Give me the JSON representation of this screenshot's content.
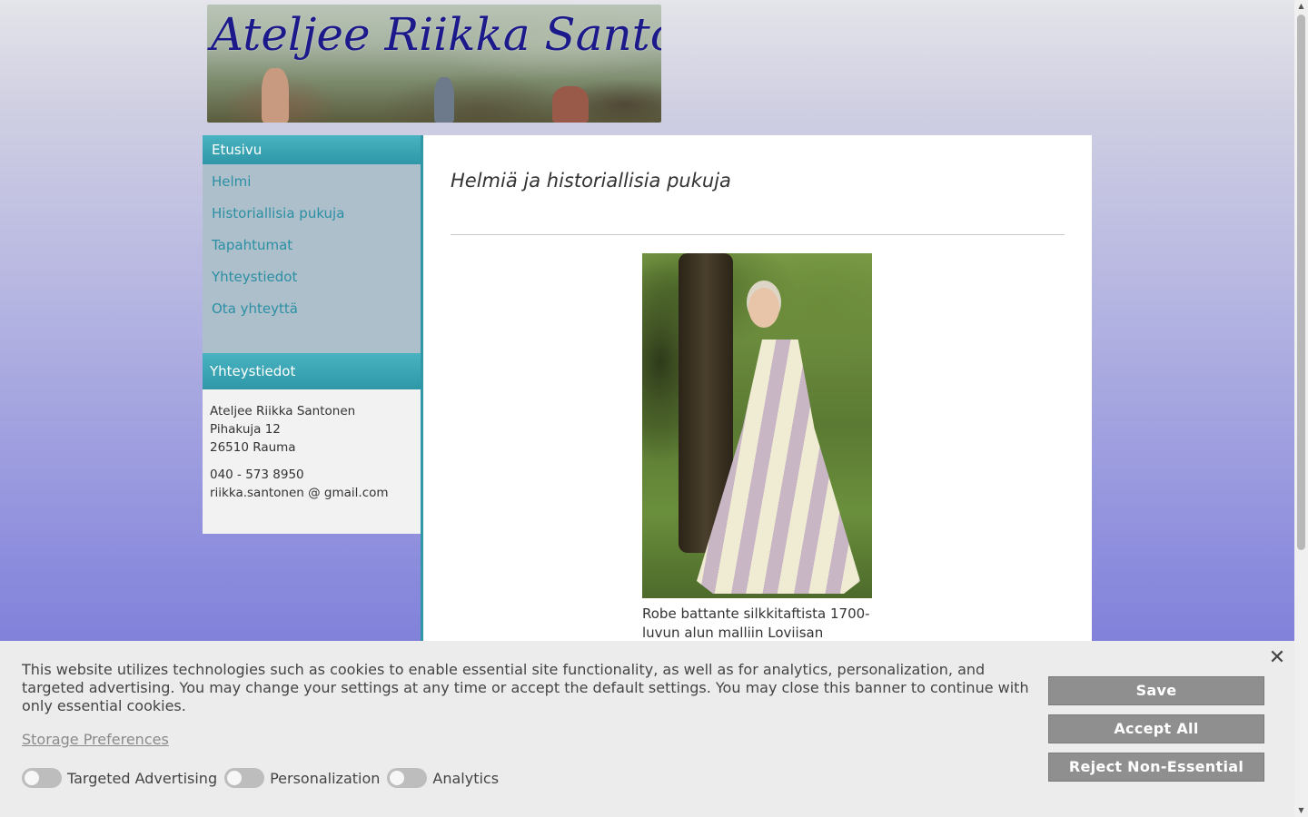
{
  "site": {
    "banner_title": "Ateljee Riikka Santonen"
  },
  "nav": {
    "items": [
      {
        "label": "Etusivu",
        "active": true
      },
      {
        "label": "Helmi"
      },
      {
        "label": "Historiallisia pukuja"
      },
      {
        "label": "Tapahtumat"
      },
      {
        "label": "Yhteystiedot"
      },
      {
        "label": "Ota yhteyttä"
      }
    ]
  },
  "contact": {
    "heading": "Yhteystiedot",
    "name": "Ateljee Riikka Santonen",
    "street": "Pihakuja 12",
    "city": "26510 Rauma",
    "phone": "040 - 573 8950",
    "email": "riikka.santonen @ gmail.com"
  },
  "main": {
    "title": "Helmiä ja historiallisia pukuja",
    "caption": "Robe battante silkkitaftista 1700-luvun alun malliin Loviisan"
  },
  "cookie_banner": {
    "text": "This website utilizes technologies such as cookies to enable essential site functionality, as well as for analytics, personalization, and targeted advertising. You may change your settings at any time or accept the default settings. You may close this banner to continue with only essential cookies.",
    "storage_link": "Storage Preferences",
    "toggles": [
      {
        "label": "Targeted Advertising",
        "on": false
      },
      {
        "label": "Personalization",
        "on": false
      },
      {
        "label": "Analytics",
        "on": false
      }
    ],
    "buttons": {
      "save": "Save",
      "accept_all": "Accept All",
      "reject": "Reject Non-Essential"
    },
    "close_icon": "close-icon"
  },
  "colors": {
    "accent": "#2f97a7",
    "nav_bg": "#adbfca",
    "button_bg": "#8f8f8f"
  }
}
